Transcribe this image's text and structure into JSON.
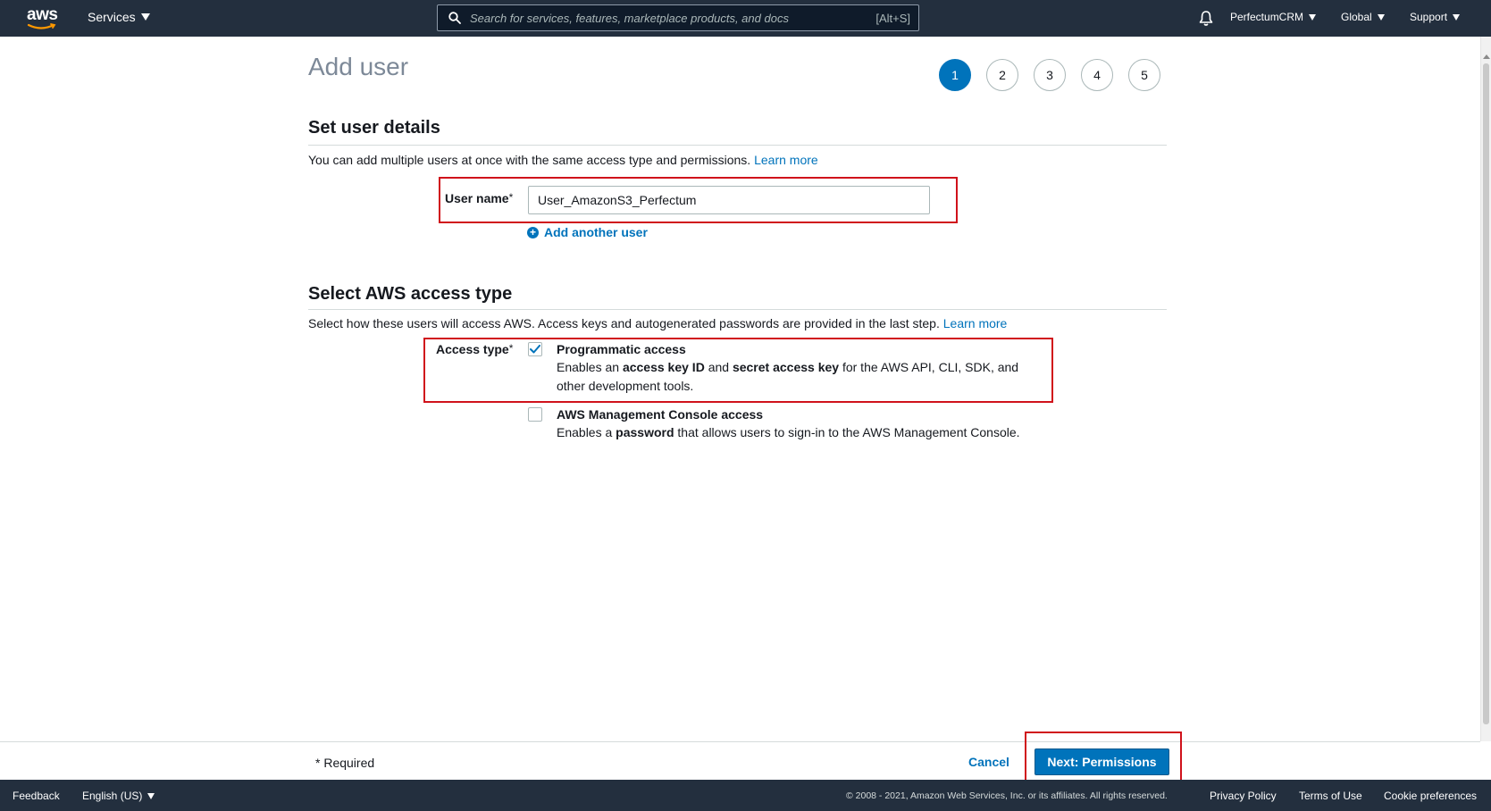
{
  "topnav": {
    "logo": "aws",
    "services_label": "Services",
    "search_placeholder": "Search for services, features, marketplace products, and docs",
    "search_shortcut": "[Alt+S]",
    "account": "PerfectumCRM",
    "region": "Global",
    "support": "Support",
    "bell_icon": "bell-icon"
  },
  "page": {
    "title": "Add user",
    "steps": [
      "1",
      "2",
      "3",
      "4",
      "5"
    ],
    "active_step": "1"
  },
  "user_details": {
    "title": "Set user details",
    "description": "You can add multiple users at once with the same access type and permissions.",
    "learn_more": "Learn more",
    "user_name_label": "User name",
    "required_star": "*",
    "user_name_value": "User_AmazonS3_Perfectum",
    "add_another_user": "Add another user"
  },
  "access_type": {
    "title": "Select AWS access type",
    "description": "Select how these users will access AWS. Access keys and autogenerated passwords are provided in the last step.",
    "learn_more": "Learn more",
    "label": "Access type",
    "required_star": "*",
    "options": [
      {
        "title": "Programmatic access",
        "checked": true,
        "desc_parts": [
          "Enables an ",
          "access key ID",
          " and ",
          "secret access key",
          " for the AWS API, CLI, SDK, and other development tools."
        ]
      },
      {
        "title": "AWS Management Console access",
        "checked": false,
        "desc_parts": [
          "Enables a ",
          "password",
          " that allows users to sign-in to the AWS Management Console."
        ]
      }
    ]
  },
  "actions": {
    "required_note": "* Required",
    "cancel": "Cancel",
    "next": "Next: Permissions"
  },
  "footer": {
    "feedback": "Feedback",
    "language": "English (US)",
    "copyright": "© 2008 - 2021, Amazon Web Services, Inc. or its affiliates. All rights reserved.",
    "privacy": "Privacy Policy",
    "terms": "Terms of Use",
    "cookies": "Cookie preferences"
  },
  "colors": {
    "nav_bg": "#232f3e",
    "link": "#0073bb",
    "primary_button": "#0073bb",
    "highlight": "#d0121b"
  }
}
